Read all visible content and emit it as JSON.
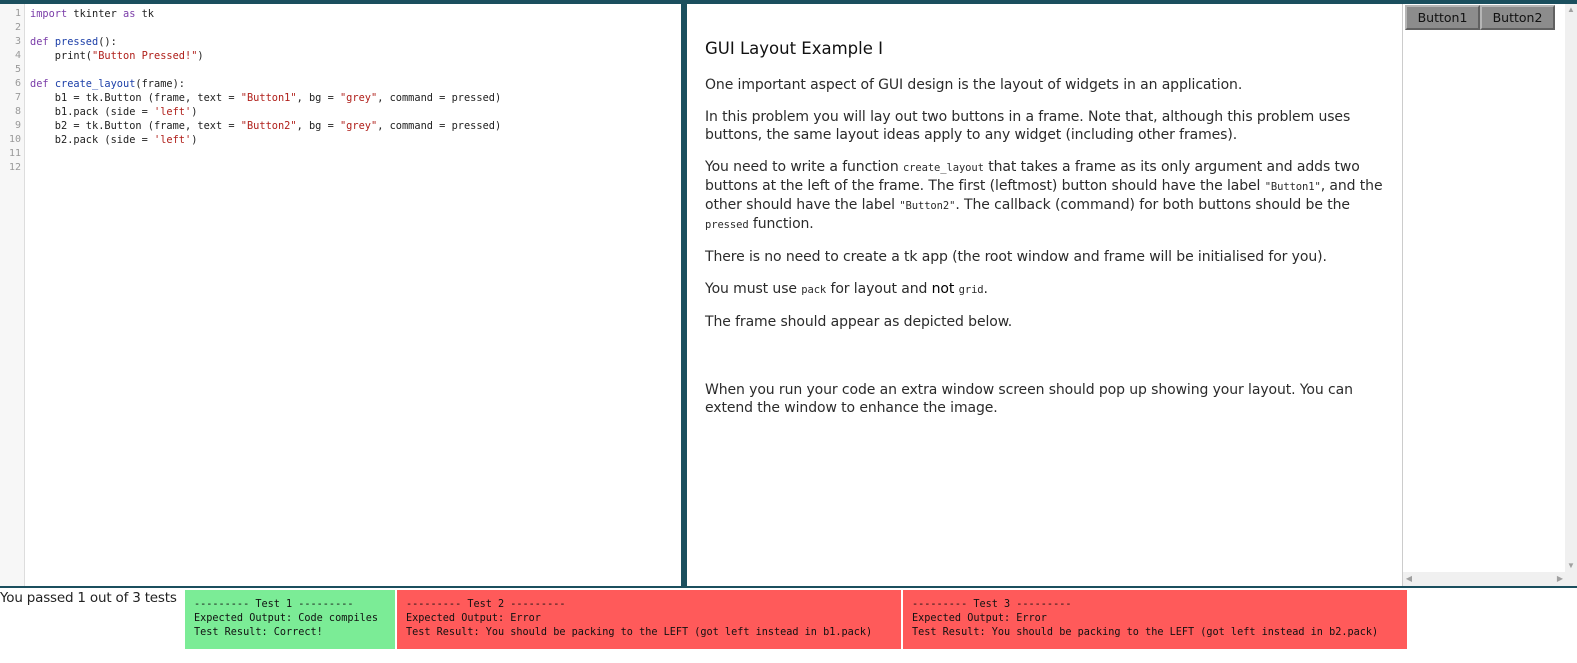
{
  "editor": {
    "line_numbers": [
      "1",
      "2",
      "3",
      "4",
      "5",
      "6",
      "7",
      "8",
      "9",
      "10",
      "11",
      "12"
    ],
    "code": {
      "l1_kw": "import",
      "l1_a": " tkinter ",
      "l1_kw2": "as",
      "l1_b": " tk",
      "l3_kw": "def",
      "l3_sp": " ",
      "l3_fn": "pressed",
      "l3_rest": "():",
      "l4_a": "    print(",
      "l4_str": "\"Button Pressed!\"",
      "l4_b": ")",
      "l6_kw": "def",
      "l6_sp": " ",
      "l6_fn": "create_layout",
      "l6_rest": "(frame):",
      "l7_a": "    b1 = tk.Button (frame, text = ",
      "l7_s1": "\"Button1\"",
      "l7_b": ", bg = ",
      "l7_s2": "\"grey\"",
      "l7_c": ", command = pressed)",
      "l8_a": "    b1.pack (side = ",
      "l8_s": "'left'",
      "l8_b": ")",
      "l9_a": "    b2 = tk.Button (frame, text = ",
      "l9_s1": "\"Button2\"",
      "l9_b": ", bg = ",
      "l9_s2": "\"grey\"",
      "l9_c": ", command = pressed)",
      "l10_a": "    b2.pack (side = ",
      "l10_s": "'left'",
      "l10_b": ")"
    }
  },
  "description": {
    "title": "GUI Layout Example I",
    "p1": "One important aspect of GUI design is the layout of widgets in an application.",
    "p2": "In this problem you will lay out two buttons in a frame. Note that, although this problem uses buttons, the same layout ideas apply to any widget (including other frames).",
    "p3_a": "You need to write a function ",
    "p3_code1": "create_layout",
    "p3_b": " that takes a frame as its only argument and adds two buttons at the left of the frame. The first (leftmost) button should have the label ",
    "p3_code2": "\"Button1\"",
    "p3_c": ", and the other should have the label ",
    "p3_code3": "\"Button2\"",
    "p3_d": ". The callback (command) for both buttons should be the ",
    "p3_code4": "pressed",
    "p3_e": " function.",
    "p4": "There is no need to create a tk app (the root window and frame will be initialised for you).",
    "p5_a": "You must use ",
    "p5_code1": "pack",
    "p5_b": " for layout and ",
    "p5_not": "not",
    "p5_c": " ",
    "p5_code2": "grid",
    "p5_d": ".",
    "p6": "The frame should appear as depicted below.",
    "p7": "When you run your code an extra window screen should pop up showing your layout. You can extend the window to enhance the image."
  },
  "output": {
    "button1": "Button1",
    "button2": "Button2"
  },
  "results": {
    "summary": "You passed 1 out of 3 tests",
    "tests": [
      {
        "header": "--------- Test 1 ---------",
        "expected": "Expected Output: Code compiles",
        "result": "Test Result: Correct!",
        "status": "pass"
      },
      {
        "header": "--------- Test 2 ---------",
        "expected": "Expected Output: Error",
        "result": "Test Result: You should be packing to the LEFT (got left instead in b1.pack)",
        "status": "fail"
      },
      {
        "header": "--------- Test 3 ---------",
        "expected": "Expected Output: Error",
        "result": "Test Result: You should be packing to the LEFT (got left instead in b2.pack)",
        "status": "fail"
      }
    ]
  },
  "colors": {
    "accent": "#1b4f5e",
    "pass": "#7bec96",
    "fail": "#ff5a5a",
    "tk_button": "#8c8c8c"
  },
  "icons": {
    "scroll_up": "triangle-up-icon",
    "scroll_down": "triangle-down-icon",
    "scroll_left": "triangle-left-icon",
    "scroll_right": "triangle-right-icon"
  }
}
